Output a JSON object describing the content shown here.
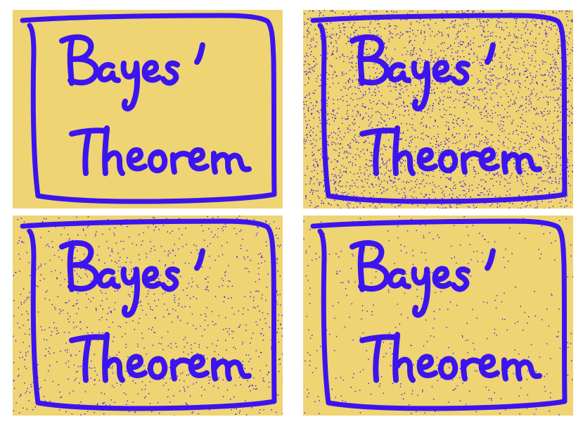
{
  "colors": {
    "background": "#EED473",
    "ink": "#3B14F0",
    "page": "#FFFFFF"
  },
  "handwriting": {
    "line1": "Bayes'",
    "line2": "Theorem"
  },
  "panels": [
    {
      "id": "original",
      "noise_density": 0.0
    },
    {
      "id": "heavy-noise",
      "noise_density": 0.35
    },
    {
      "id": "medium-noise",
      "noise_density": 0.12
    },
    {
      "id": "light-noise",
      "noise_density": 0.05
    }
  ]
}
